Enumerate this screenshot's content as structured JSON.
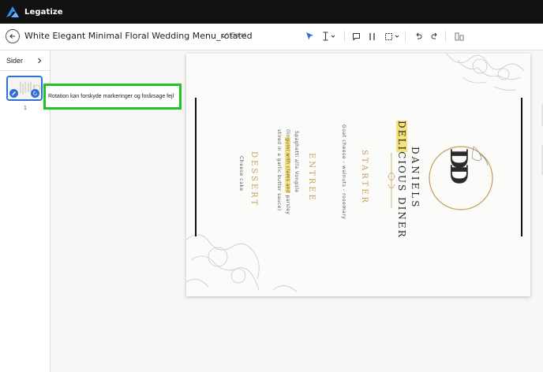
{
  "app": {
    "name": "Legatize"
  },
  "toolbar": {
    "back_icon": "arrow-left-icon",
    "doc_title": "White Elegant Minimal Floral Wedding Menu_rotated",
    "saved_label": "Gemt",
    "tools": [
      "pointer-icon",
      "text-cursor-icon",
      "comment-icon",
      "columns-icon",
      "select-area-icon",
      "undo-icon",
      "redo-icon",
      "split-view-icon"
    ]
  },
  "sidebar": {
    "title": "Sider",
    "pages": [
      {
        "number": "1"
      }
    ]
  },
  "tooltip": {
    "text": "Rotation kan forskyde markeringer og forårsage fejl"
  },
  "menu": {
    "monogram": "DD",
    "restaurant": "DANIELS",
    "subtitle": "DELICIOUS DINER",
    "starter_heading": "STARTER",
    "starter_desc": "Goat cheese - walnuts - rosemary",
    "entree_heading": "ENTREE",
    "entree_desc_1": "Spaghetti alla Vongole",
    "entree_desc_2": "(linguini with clams and parsley",
    "entree_desc_3": "stired in a garlic butter sauce)",
    "dessert_heading": "DESSERT",
    "dessert_desc": "Cheese cake"
  },
  "colors": {
    "topbar": "#111111",
    "accent": "#2f6fd6",
    "highlight": "#22c322",
    "gold": "#c4a05c",
    "text_highlight": "#f5e27a"
  }
}
